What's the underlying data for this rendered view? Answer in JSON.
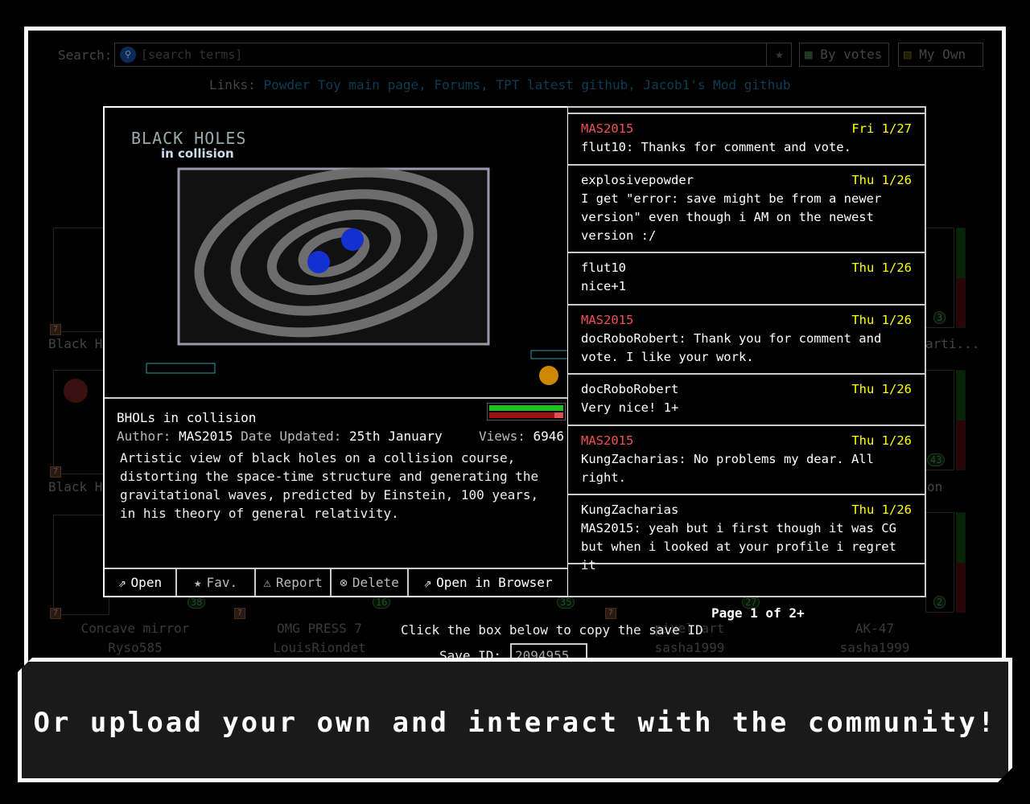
{
  "search": {
    "label": "Search:",
    "placeholder": "[search terms]",
    "sort_label": "By votes",
    "my_own_label": "My Own"
  },
  "links": {
    "label": "Links:",
    "items": [
      "Powder Toy main page,",
      "Forums,",
      "TPT latest github,",
      "Jacob1's Mod github"
    ]
  },
  "background": {
    "titles": [
      "Black H",
      "Black H",
      "arti...",
      "on",
      "Concave mirror",
      "OMG PRESS 7",
      "pixel art",
      "AK-47"
    ],
    "authors": [
      "Ryso585",
      "LouisRiondet",
      "sasha1999",
      "sasha1999"
    ],
    "votes": [
      "3",
      "43",
      "38",
      "16",
      "35",
      "27",
      "2"
    ],
    "seven": "7"
  },
  "save": {
    "preview_title": "BLACK HOLES",
    "preview_subtitle": "in collision",
    "name": "BHOLs in collision",
    "author_label": "Author:",
    "author": "MAS2015",
    "date_label": "Date Updated:",
    "date": "25th January",
    "views_label": "Views:",
    "views": "6946",
    "description": "Artistic view of black holes on a collision course, distorting the space-time structure and generating the gravitational waves, predicted by Einstein, 100 years, in his theory of general relativity.",
    "score_up_fraction": 1.0,
    "score_down_fraction": 0.12,
    "buttons": {
      "open": "Open",
      "fav": "Fav.",
      "report": "Report",
      "delete": "Delete",
      "open_browser": "Open in Browser"
    }
  },
  "comments": [
    {
      "user": "MAS2015",
      "date": "Fri 1/27",
      "text": "flut10: Thanks for comment and vote.",
      "owner": true
    },
    {
      "user": "explosivepowder",
      "date": "Thu 1/26",
      "text": "I get \"error: save might be from a newer version\" even though i AM on the newest version :/",
      "owner": false
    },
    {
      "user": "flut10",
      "date": "Thu 1/26",
      "text": "nice+1",
      "owner": false
    },
    {
      "user": "MAS2015",
      "date": "Thu 1/26",
      "text": "docRoboRobert: Thank you for comment and vote. I like your work.",
      "owner": true
    },
    {
      "user": "docRoboRobert",
      "date": "Thu 1/26",
      "text": "Very nice! 1+",
      "owner": false
    },
    {
      "user": "MAS2015",
      "date": "Thu 1/26",
      "text": "KungZacharias: No problems my dear. All right.",
      "owner": true
    },
    {
      "user": "KungZacharias",
      "date": "Thu 1/26",
      "text": "MAS2015: yeah but i first though it was CG but when i looked at your profile i regret it",
      "owner": false
    }
  ],
  "pagination": {
    "text": "Page 1 of 2+"
  },
  "saveid": {
    "hint": "Click the box below to copy the save ID",
    "label": "Save ID:",
    "value": "2094955"
  },
  "banner": {
    "text": "Or upload your own and interact with the community!"
  },
  "colors": {
    "owner": "#f05050",
    "date": "#ffff00",
    "link": "#0b3d55",
    "vote_up": "#20c020",
    "vote_down": "#a01010"
  }
}
